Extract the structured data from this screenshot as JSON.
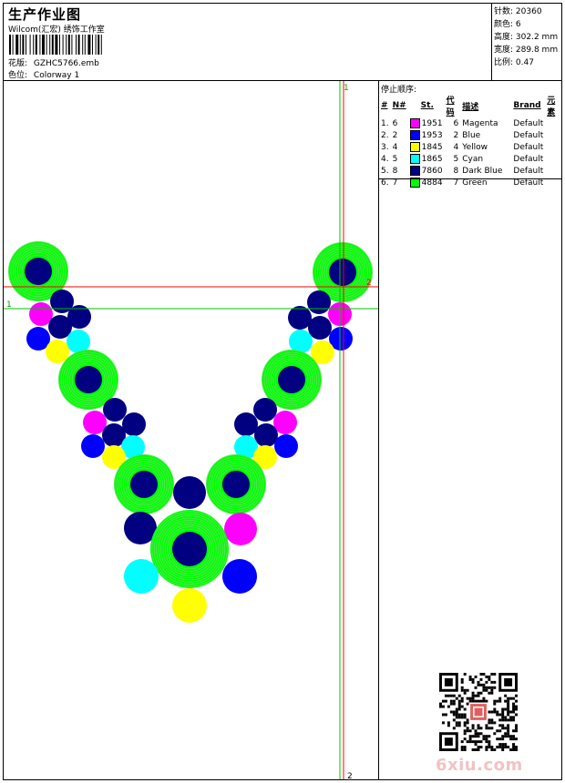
{
  "header": {
    "title": "生产作业图",
    "subtitle": "Wilcom(汇宏) 绣饰工作室",
    "design_label": "花版:",
    "design_value": "GZHC5766.emb",
    "colorway_label": "色位:",
    "colorway_value": "Colorway 1"
  },
  "stats": [
    {
      "label": "针数:",
      "value": "20360"
    },
    {
      "label": "颜色:",
      "value": "6"
    },
    {
      "label": "高度:",
      "value": "302.2 mm"
    },
    {
      "label": "宽度:",
      "value": "289.8 mm"
    },
    {
      "label": "比例:",
      "value": "0.47"
    }
  ],
  "stop_sequence": {
    "title": "停止顺序:",
    "headers": [
      "#",
      "N#",
      "St.",
      "代码",
      "描述",
      "Brand",
      "元素"
    ],
    "rows": [
      {
        "idx": "1.",
        "n": "6",
        "color": "#ff00ff",
        "st": "1951",
        "code": "6",
        "desc": "Magenta",
        "brand": "Default"
      },
      {
        "idx": "2.",
        "n": "2",
        "color": "#0000ff",
        "st": "1953",
        "code": "2",
        "desc": "Blue",
        "brand": "Default"
      },
      {
        "idx": "3.",
        "n": "4",
        "color": "#ffff00",
        "st": "1845",
        "code": "4",
        "desc": "Yellow",
        "brand": "Default"
      },
      {
        "idx": "4.",
        "n": "5",
        "color": "#00ffff",
        "st": "1865",
        "code": "5",
        "desc": "Cyan",
        "brand": "Default"
      },
      {
        "idx": "5.",
        "n": "8",
        "color": "#000080",
        "st": "7860",
        "code": "8",
        "desc": "Dark Blue",
        "brand": "Default"
      },
      {
        "idx": "6.",
        "n": "7",
        "color": "#00ff00",
        "st": "4884",
        "code": "7",
        "desc": "Green",
        "brand": "Default"
      }
    ]
  },
  "guides": {
    "v1_label": "1",
    "v2_label": "2",
    "h1_label": "1",
    "h2_label": "2"
  },
  "colors": {
    "magenta": "#ff00ff",
    "blue": "#0000ff",
    "yellow": "#ffff00",
    "cyan": "#00ffff",
    "dark_blue": "#000080",
    "green": "#00ff00",
    "guide_red": "#ff0000",
    "guide_green": "#00c000"
  },
  "watermark": "6xiu.com"
}
